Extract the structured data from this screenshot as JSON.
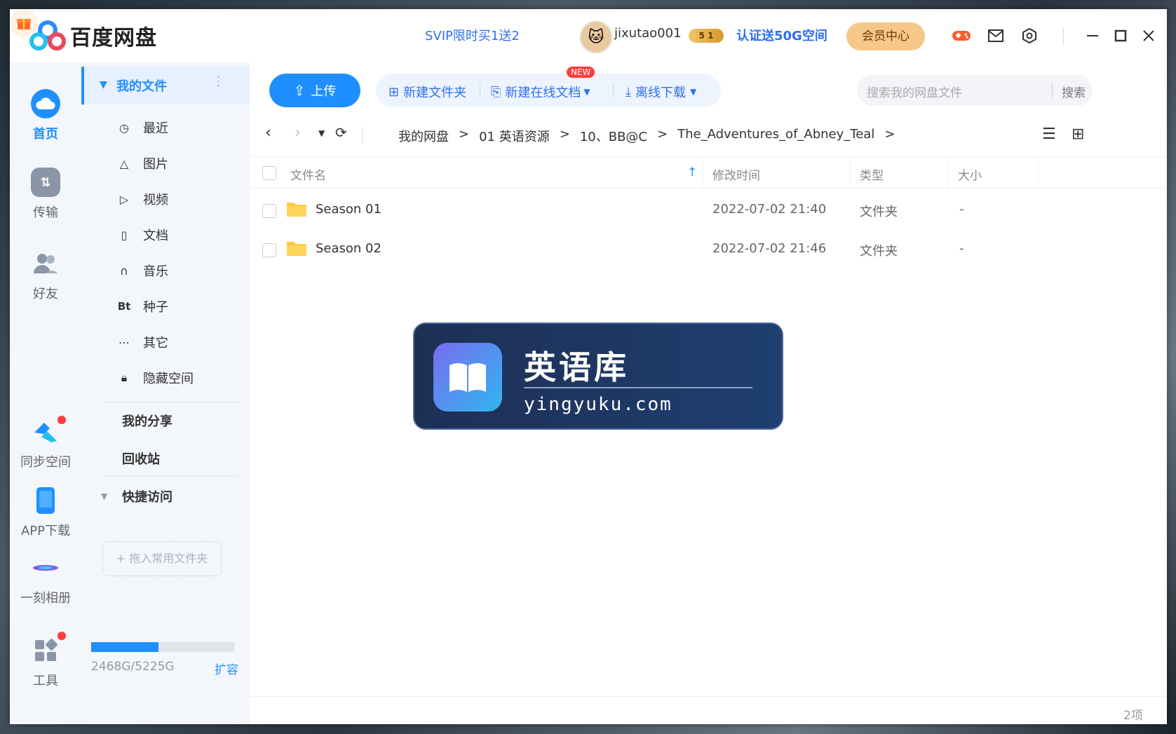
{
  "app": {
    "name": "百度网盘"
  },
  "header": {
    "promo": "SVIP限时买1送2",
    "username": "jixutao001",
    "svip_badge": "5 1",
    "verify": "认证送50G空间",
    "vip_center": "会员中心"
  },
  "leftnav": {
    "home": "首页",
    "transfer": "传输",
    "friends": "好友",
    "sync": "同步空间",
    "app_download": "APP下载",
    "moment_album": "一刻相册",
    "tools": "工具"
  },
  "sidebar": {
    "my_files": "我的文件",
    "items": [
      {
        "icon": "clock-icon",
        "label": "最近"
      },
      {
        "icon": "image-icon",
        "label": "图片"
      },
      {
        "icon": "play-icon",
        "label": "视频"
      },
      {
        "icon": "document-icon",
        "label": "文档"
      },
      {
        "icon": "headphones-icon",
        "label": "音乐"
      },
      {
        "icon": "bt-icon",
        "label": "种子"
      },
      {
        "icon": "more-icon",
        "label": "其它"
      },
      {
        "icon": "lock-icon",
        "label": "隐藏空间"
      }
    ],
    "my_share": "我的分享",
    "recycle": "回收站",
    "quick_access": "快捷访问",
    "drop_hint": "+ 拖入常用文件夹",
    "storage": {
      "text": "2468G/5225G",
      "used_fraction": 0.472
    },
    "expand": "扩容"
  },
  "toolbar": {
    "upload": "上传",
    "new_folder": "新建文件夹",
    "new_online_doc": "新建在线文档",
    "new_badge": "NEW",
    "offline_download": "离线下载",
    "search_placeholder": "搜索我的网盘文件",
    "search_button": "搜索"
  },
  "breadcrumb": [
    "我的网盘",
    "01 英语资源",
    "10、BB@C",
    "The_Adventures_of_Abney_Teal"
  ],
  "table": {
    "columns": [
      "文件名",
      "修改时间",
      "类型",
      "大小"
    ],
    "rows": [
      {
        "name": "Season 01",
        "modified": "2022-07-02 21:40",
        "type": "文件夹",
        "size": "-"
      },
      {
        "name": "Season 02",
        "modified": "2022-07-02 21:46",
        "type": "文件夹",
        "size": "-"
      }
    ]
  },
  "watermark": {
    "title": "英语库",
    "url": "yingyuku.com"
  },
  "footer": {
    "count": "2项"
  },
  "colors": {
    "accent": "#1f8fff",
    "vip": "#f5c88a",
    "link": "#2e6ff0"
  }
}
